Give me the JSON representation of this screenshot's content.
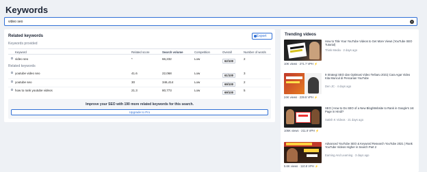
{
  "page_title": "Keywords",
  "search": {
    "value": "video seo"
  },
  "related": {
    "heading": "Related keywords",
    "export_label": "Export",
    "provided_label": "Keywords provided",
    "related_label": "Related keywords",
    "columns": {
      "keyword": "Keyword",
      "related_score": "Related score",
      "search_volume": "Search volume",
      "competition": "Competition",
      "overall": "Overall",
      "words": "Number of words"
    },
    "provided_rows": [
      {
        "keyword": "video seo",
        "score": "*",
        "volume": "66,232",
        "competition": "Low",
        "overall": "62/100",
        "words": "2"
      }
    ],
    "related_rows": [
      {
        "keyword": "youtube video seo",
        "score": "41.6",
        "volume": "22,068",
        "competition": "Low",
        "overall": "61/100",
        "words": "3"
      },
      {
        "keyword": "youtube seo",
        "score": "30",
        "volume": "346,414",
        "competition": "Low",
        "overall": "69/100",
        "words": "2"
      },
      {
        "keyword": "how to rank youtube videos",
        "score": "21.3",
        "volume": "80,773",
        "competition": "Low",
        "overall": "69/100",
        "words": "5"
      }
    ],
    "upsell_text": "Improve your SEO with 190 more related keywords for this search.",
    "upgrade_label": "Upgrade to Pro"
  },
  "trending": {
    "heading": "Trending videos",
    "videos": [
      {
        "title": "How to Title Your YouTube Videos to Get More Views (YouTube SEO Tutorial)",
        "channel": "Think Media · 2 days ago",
        "stats": "10K views · 271.7 VPH"
      },
      {
        "title": "9 Strategi SEO dan Optimasi Video Terbaru 2021| Cara Agar Video Kita Muncul di Pencarian YouTube",
        "channel": "Den JC · 4 days ago",
        "stats": "24K views · 239.8 VPH"
      },
      {
        "title": "SEO | How to Do SEO of a New Blog/Website to Rank in Google's 1st Page in Hindi?",
        "channel": "Satish K Videos · 21 days ago",
        "stats": "106K views · 211.9 VPH"
      },
      {
        "title": "Advanced YouTube SEO & Keyword Research YouTube 2021 | Rank YouTube Videos Higher in Search Part 2",
        "channel": "Earning And Learning · 3 days ago",
        "stats": "5.6K views · 110.8 VPH"
      }
    ]
  }
}
